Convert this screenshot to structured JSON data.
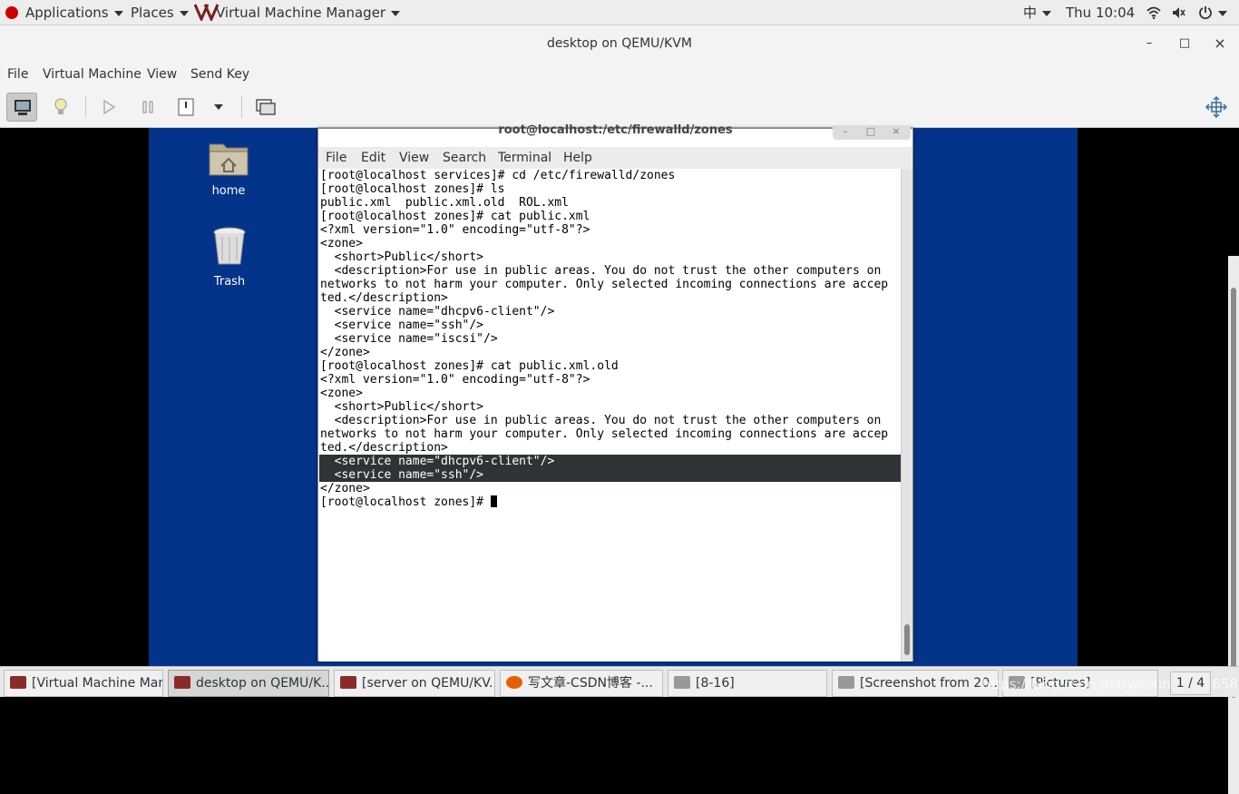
{
  "topbar": {
    "applications": "Applications",
    "places": "Places",
    "app_name": "Virtual Machine Manager",
    "input_method": "中",
    "clock": "Thu 10:04"
  },
  "window": {
    "title": "desktop on QEMU/KVM",
    "minimize": "–",
    "maximize": "□",
    "close": "×"
  },
  "menubar": {
    "file": "File",
    "virtual_machine": "Virtual Machine",
    "view": "View",
    "send_key": "Send Key"
  },
  "desktop": {
    "home_label": "home",
    "trash_label": "Trash"
  },
  "terminal": {
    "title": "root@localhost:/etc/firewalld/zones",
    "menu": {
      "file": "File",
      "edit": "Edit",
      "view": "View",
      "search": "Search",
      "terminal": "Terminal",
      "help": "Help"
    },
    "lines": [
      "[root@localhost services]# cd /etc/firewalld/zones",
      "[root@localhost zones]# ls",
      "public.xml  public.xml.old  ROL.xml",
      "[root@localhost zones]# cat public.xml",
      "<?xml version=\"1.0\" encoding=\"utf-8\"?>",
      "<zone>",
      "  <short>Public</short>",
      "  <description>For use in public areas. You do not trust the other computers on",
      "networks to not harm your computer. Only selected incoming connections are accep",
      "ted.</description>",
      "  <service name=\"dhcpv6-client\"/>",
      "  <service name=\"ssh\"/>",
      "  <service name=\"iscsi\"/>",
      "</zone>",
      "[root@localhost zones]# cat public.xml.old",
      "<?xml version=\"1.0\" encoding=\"utf-8\"?>",
      "<zone>",
      "  <short>Public</short>",
      "  <description>For use in public areas. You do not trust the other computers on",
      "networks to not harm your computer. Only selected incoming connections are accep",
      "ted.</description>",
      "  <service name=\"dhcpv6-client\"/>",
      "  <service name=\"ssh\"/>",
      "</zone>",
      "[root@localhost zones]# "
    ],
    "highlighted_lines": [
      21,
      22
    ]
  },
  "taskbar": {
    "tasks": [
      {
        "label": "[Virtual Machine Man...",
        "active": false
      },
      {
        "label": "desktop on QEMU/K...",
        "active": true
      },
      {
        "label": "[server on QEMU/KV...",
        "active": false
      },
      {
        "label": "写文章-CSDN博客 -...",
        "active": false
      },
      {
        "label": "[8-16]",
        "active": false
      },
      {
        "label": "[Screenshot from 20...",
        "active": false
      },
      {
        "label": "[Pictures]",
        "active": false
      }
    ],
    "pager": "1 / 4",
    "watermark": "https://blog.csdn.net/weixin_43956581"
  }
}
